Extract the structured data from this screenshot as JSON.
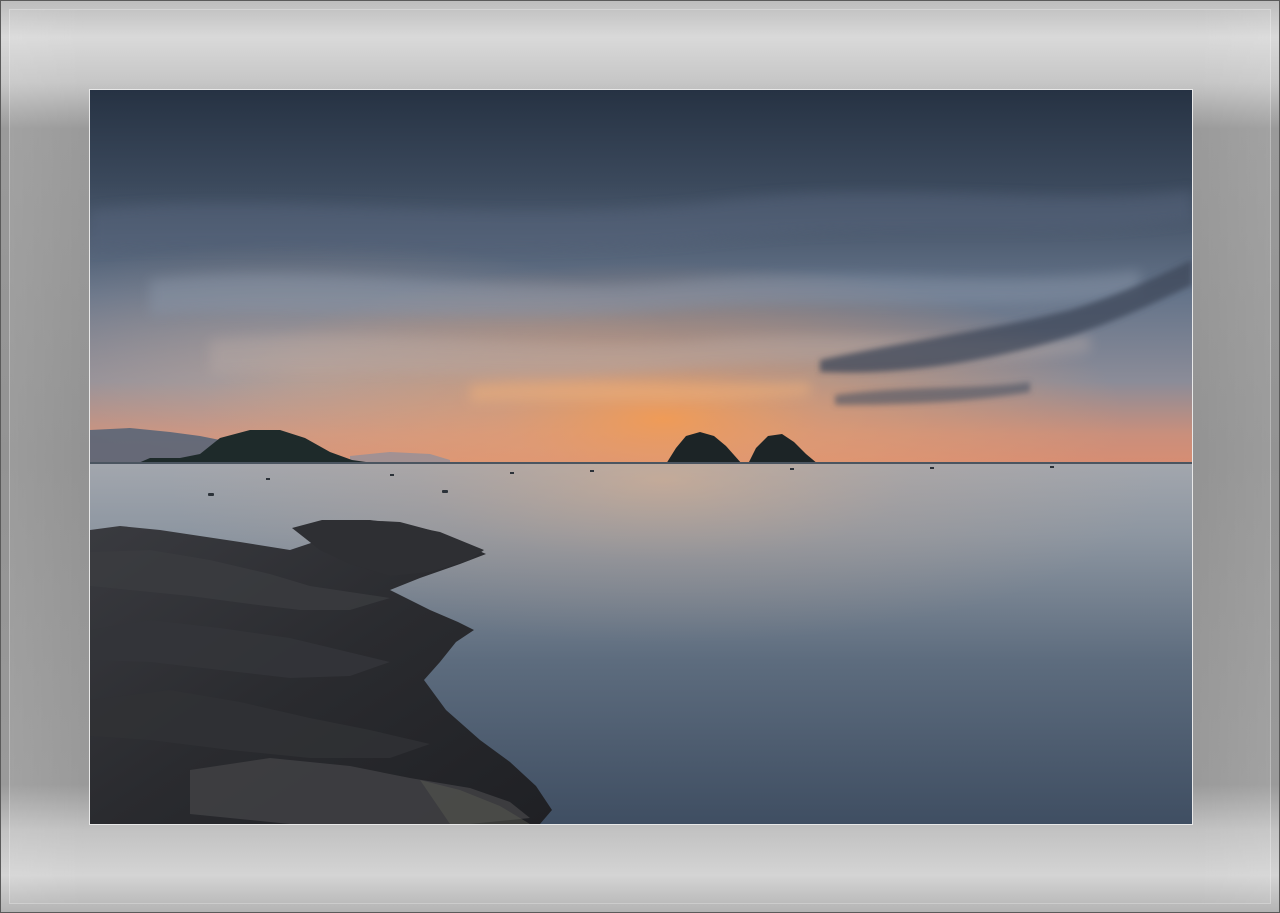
{
  "photo": {
    "subject": "seascape-at-dusk",
    "colors": {
      "sky_top": "#2e3a4d",
      "sky_mid": "#6f7e91",
      "sky_glow": "#e99a5a",
      "horizon_pink": "#d98a82",
      "sea_top": "#9aa3ad",
      "sea_bottom": "#45556a",
      "rock": "#2b2c30",
      "frame": "#939393"
    }
  }
}
